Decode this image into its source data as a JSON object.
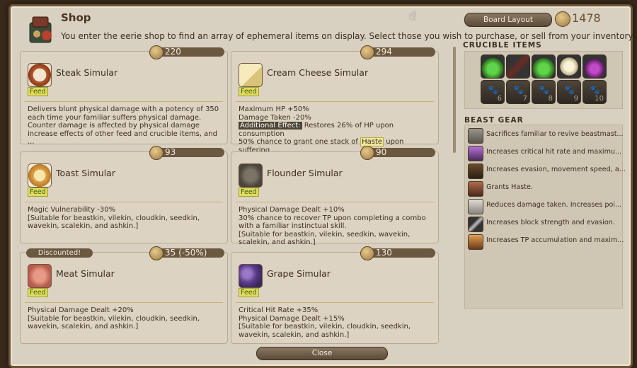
{
  "window": {
    "title": "Shop",
    "description": "You enter the eerie shop to find an array of ephemeral items on display. Select those you wish to purchase, or sell from your inventory.",
    "board_layout_label": "Board Layout",
    "gil": "1478",
    "close_label": "Close"
  },
  "items": [
    {
      "name": "Steak Simular",
      "price": "220",
      "type": "Feed",
      "desc": "Delivers blunt physical damage with a potency of 350 each time your familiar suffers physical damage. Counter damage is affected by physical damage increase effects of other feed and crucible items, and ..."
    },
    {
      "name": "Cream Cheese Simular",
      "price": "294",
      "type": "Feed",
      "desc_line1": "Maximum HP +50%",
      "desc_line2": "Damage Taken -20%",
      "desc_line3_label": "Additional Effect:",
      "desc_line3_rest": " Restores 26% of HP upon consumption",
      "desc_line4_pre": "50% chance to grant one stack of ",
      "desc_line4_hl": "Haste",
      "desc_line4_post": " upon suffering ..."
    },
    {
      "name": "Toast Simular",
      "price": "93",
      "type": "Feed",
      "desc": "Magic Vulnerability -30%\n[Suitable for beastkin, vilekin, cloudkin, seedkin, wavekin, scalekin, and ashkin.]"
    },
    {
      "name": "Flounder Simular",
      "price": "90",
      "type": "Feed",
      "desc": "Physical Damage Dealt +10%\n30% chance to recover TP upon completing a combo with a familiar instinctual skill.\n[Suitable for beastkin, vilekin, seedkin, wavekin, scalekin, and ashkin.]"
    },
    {
      "name": "Meat Simular",
      "price": "35 (-50%)",
      "type": "Feed",
      "discount": "Discounted!",
      "desc": "Physical Damage Dealt +20%\n[Suitable for beastkin, vilekin, cloudkin, seedkin, wavekin, scalekin, and ashkin.]"
    },
    {
      "name": "Grape Simular",
      "price": "130",
      "type": "Feed",
      "desc": "Critical Hit Rate +35%\nPhysical Damage Dealt +15%\n[Suitable for beastkin, vilekin, cloudkin, seedkin, wavekin, scalekin, and ashkin.]"
    }
  ],
  "crucible": {
    "title": "CRUCIBLE ITEMS",
    "empty_slots": [
      "6",
      "7",
      "8",
      "9",
      "10"
    ]
  },
  "beast_gear": {
    "title": "BEAST GEAR",
    "items": [
      "Sacrifices familiar to revive beastmast...",
      "Increases critical hit rate and maximu...",
      "Increases evasion, movement speed, a...",
      "Grants Haste.",
      "Reduces damage taken. Increases poi...",
      "Increases block strength and evasion.",
      "Increases TP accumulation and maxim..."
    ]
  }
}
